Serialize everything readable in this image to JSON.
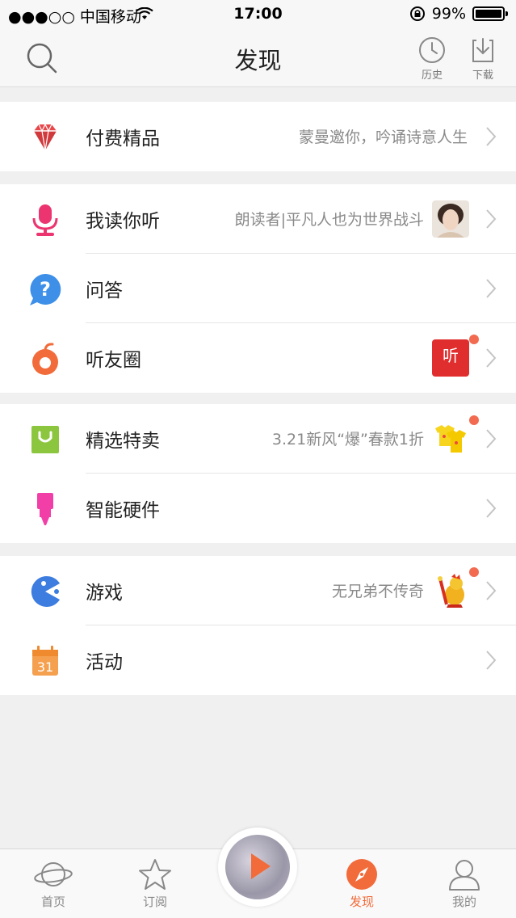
{
  "status_bar": {
    "carrier": "●●●○○ 中国移动",
    "time": "17:00",
    "battery": "99%"
  },
  "nav": {
    "title": "发现",
    "history_label": "历史",
    "download_label": "下载"
  },
  "groups": [
    {
      "items": [
        {
          "label": "付费精品",
          "subtitle": "蒙曼邀你，吟诵诗意人生",
          "icon": "diamond-icon"
        }
      ]
    },
    {
      "items": [
        {
          "label": "我读你听",
          "subtitle": "朗读者|平凡人也为世界战斗",
          "icon": "microphone-icon",
          "thumb": "reader-avatar"
        },
        {
          "label": "问答",
          "subtitle": "",
          "icon": "question-bubble-icon"
        },
        {
          "label": "听友圈",
          "subtitle": "",
          "icon": "music-note-icon",
          "thumb": "ting-app-thumbnail",
          "thumb_text": "听"
        }
      ]
    },
    {
      "items": [
        {
          "label": "精选特卖",
          "subtitle": "3.21新风“爆”春款1折",
          "icon": "shopping-bag-icon",
          "thumb": "yellow-shirts-thumbnail"
        },
        {
          "label": "智能硬件",
          "subtitle": "",
          "icon": "smart-device-icon"
        }
      ]
    },
    {
      "items": [
        {
          "label": "游戏",
          "subtitle": "无兄弟不传奇",
          "icon": "pacman-game-icon",
          "thumb": "game-character-thumbnail"
        },
        {
          "label": "活动",
          "subtitle": "",
          "icon": "calendar-icon",
          "calendar_day": "31"
        }
      ]
    }
  ],
  "tabbar": {
    "tabs": [
      {
        "label": "首页",
        "icon": "planet-icon"
      },
      {
        "label": "订阅",
        "icon": "star-icon"
      },
      {
        "label": "发现",
        "icon": "compass-icon",
        "active": true
      },
      {
        "label": "我的",
        "icon": "user-icon"
      }
    ]
  },
  "colors": {
    "accent": "#f26b3a",
    "badge": "#f26b50",
    "background": "#f0f0f0"
  }
}
